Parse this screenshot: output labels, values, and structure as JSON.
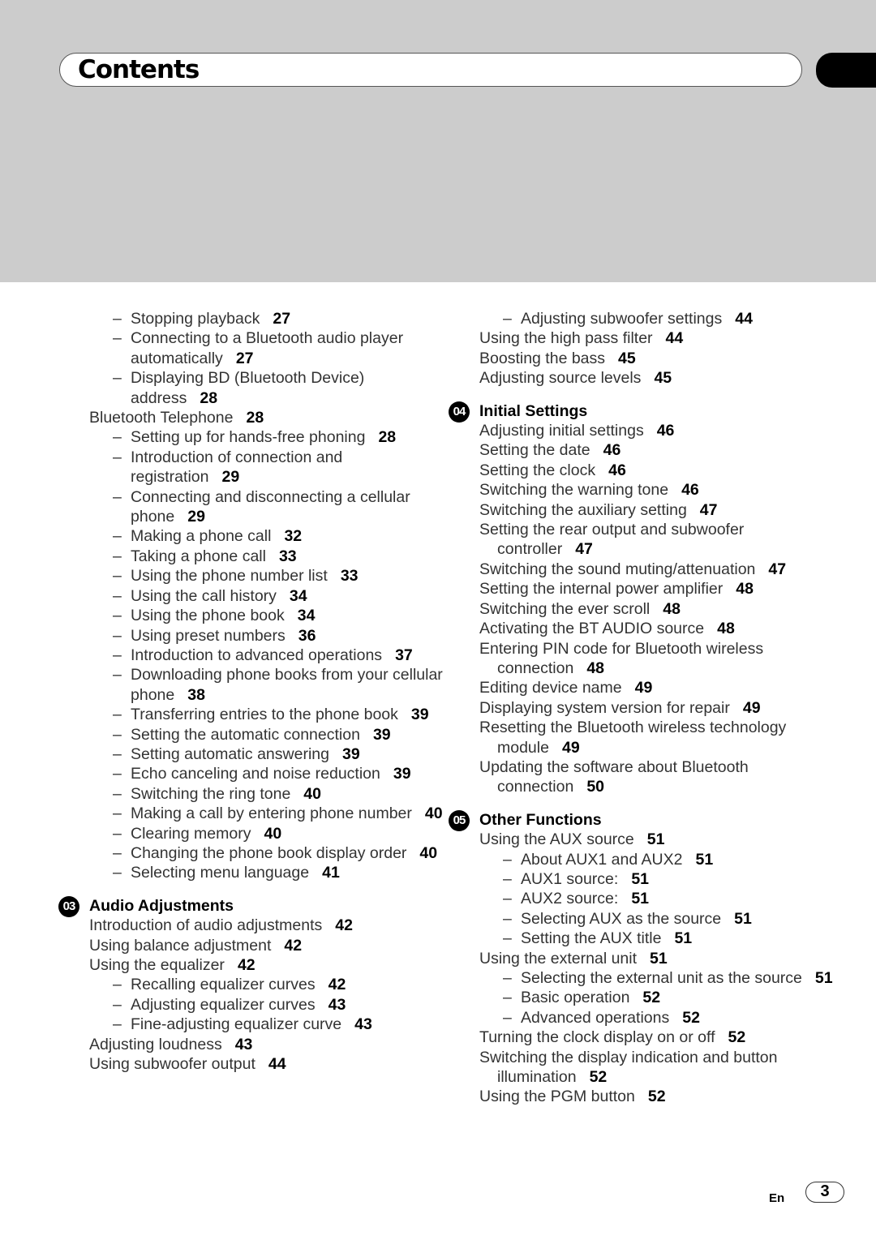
{
  "header": {
    "title": "Contents"
  },
  "left_column": [
    {
      "type": "sub",
      "text": "Stopping playback",
      "page": "27"
    },
    {
      "type": "sub",
      "text": "Connecting to a Bluetooth audio player automatically",
      "page": "27"
    },
    {
      "type": "sub",
      "text": "Displaying BD (Bluetooth Device) address",
      "page": "28"
    },
    {
      "type": "item",
      "text": "Bluetooth Telephone",
      "page": "28"
    },
    {
      "type": "sub",
      "text": "Setting up for hands-free phoning",
      "page": "28"
    },
    {
      "type": "sub",
      "text": "Introduction of connection and registration",
      "page": "29"
    },
    {
      "type": "sub",
      "text": "Connecting and disconnecting a cellular phone",
      "page": "29"
    },
    {
      "type": "sub",
      "text": "Making a phone call",
      "page": "32"
    },
    {
      "type": "sub",
      "text": "Taking a phone call",
      "page": "33"
    },
    {
      "type": "sub",
      "text": "Using the phone number list",
      "page": "33"
    },
    {
      "type": "sub",
      "text": "Using the call history",
      "page": "34"
    },
    {
      "type": "sub",
      "text": "Using the phone book",
      "page": "34"
    },
    {
      "type": "sub",
      "text": "Using preset numbers",
      "page": "36"
    },
    {
      "type": "sub",
      "text": "Introduction to advanced operations",
      "page": "37"
    },
    {
      "type": "sub",
      "text": "Downloading phone books from your cellular phone",
      "page": "38"
    },
    {
      "type": "sub",
      "text": "Transferring entries to the phone book",
      "page": "39"
    },
    {
      "type": "sub",
      "text": "Setting the automatic connection",
      "page": "39"
    },
    {
      "type": "sub",
      "text": "Setting automatic answering",
      "page": "39"
    },
    {
      "type": "sub",
      "text": "Echo canceling and noise reduction",
      "page": "39"
    },
    {
      "type": "sub",
      "text": "Switching the ring tone",
      "page": "40"
    },
    {
      "type": "sub",
      "text": "Making a call by entering phone number",
      "page": "40"
    },
    {
      "type": "sub",
      "text": "Clearing memory",
      "page": "40"
    },
    {
      "type": "sub",
      "text": "Changing the phone book display order",
      "page": "40"
    },
    {
      "type": "sub",
      "text": "Selecting menu language",
      "page": "41"
    },
    {
      "type": "section",
      "number": "03",
      "text": "Audio Adjustments"
    },
    {
      "type": "item",
      "text": "Introduction of audio adjustments",
      "page": "42"
    },
    {
      "type": "item",
      "text": "Using balance adjustment",
      "page": "42"
    },
    {
      "type": "item",
      "text": "Using the equalizer",
      "page": "42"
    },
    {
      "type": "sub",
      "text": "Recalling equalizer curves",
      "page": "42"
    },
    {
      "type": "sub",
      "text": "Adjusting equalizer curves",
      "page": "43"
    },
    {
      "type": "sub",
      "text": "Fine-adjusting equalizer curve",
      "page": "43"
    },
    {
      "type": "item",
      "text": "Adjusting loudness",
      "page": "43"
    },
    {
      "type": "item",
      "text": "Using subwoofer output",
      "page": "44"
    }
  ],
  "right_column": [
    {
      "type": "sub",
      "text": "Adjusting subwoofer settings",
      "page": "44"
    },
    {
      "type": "item",
      "text": "Using the high pass filter",
      "page": "44"
    },
    {
      "type": "item",
      "text": "Boosting the bass",
      "page": "45"
    },
    {
      "type": "item",
      "text": "Adjusting source levels",
      "page": "45"
    },
    {
      "type": "section",
      "number": "04",
      "text": "Initial Settings"
    },
    {
      "type": "item",
      "text": "Adjusting initial settings",
      "page": "46"
    },
    {
      "type": "item",
      "text": "Setting the date",
      "page": "46"
    },
    {
      "type": "item",
      "text": "Setting the clock",
      "page": "46"
    },
    {
      "type": "item",
      "text": "Switching the warning tone",
      "page": "46"
    },
    {
      "type": "item",
      "text": "Switching the auxiliary setting",
      "page": "47"
    },
    {
      "type": "item",
      "text": "Setting the rear output and subwoofer",
      "cont": "controller",
      "page": "47"
    },
    {
      "type": "item",
      "text": "Switching the sound muting/attenuation",
      "page": "47"
    },
    {
      "type": "item",
      "text": "Setting the internal power amplifier",
      "page": "48"
    },
    {
      "type": "item",
      "text": "Switching the ever scroll",
      "page": "48"
    },
    {
      "type": "item",
      "text": "Activating the BT AUDIO source",
      "page": "48"
    },
    {
      "type": "item",
      "text": "Entering PIN code for Bluetooth wireless",
      "cont": "connection",
      "page": "48"
    },
    {
      "type": "item",
      "text": "Editing device name",
      "page": "49"
    },
    {
      "type": "item",
      "text": "Displaying system version for repair",
      "page": "49"
    },
    {
      "type": "item",
      "text": "Resetting the Bluetooth wireless technology",
      "cont": "module",
      "page": "49"
    },
    {
      "type": "item",
      "text": "Updating the software about Bluetooth",
      "cont": "connection",
      "page": "50"
    },
    {
      "type": "section",
      "number": "05",
      "text": "Other Functions"
    },
    {
      "type": "item",
      "text": "Using the AUX source",
      "page": "51"
    },
    {
      "type": "sub",
      "text": "About AUX1 and AUX2",
      "page": "51"
    },
    {
      "type": "sub",
      "text": "AUX1 source:",
      "page": "51"
    },
    {
      "type": "sub",
      "text": "AUX2 source:",
      "page": "51"
    },
    {
      "type": "sub",
      "text": "Selecting AUX as the source",
      "page": "51"
    },
    {
      "type": "sub",
      "text": "Setting the AUX title",
      "page": "51"
    },
    {
      "type": "item",
      "text": "Using the external unit",
      "page": "51"
    },
    {
      "type": "sub",
      "text": "Selecting the external unit as the source",
      "page": "51"
    },
    {
      "type": "sub",
      "text": "Basic operation",
      "page": "52"
    },
    {
      "type": "sub",
      "text": "Advanced operations",
      "page": "52"
    },
    {
      "type": "item",
      "text": "Turning the clock display on or off",
      "page": "52"
    },
    {
      "type": "item",
      "text": "Switching the display indication and button",
      "cont": "illumination",
      "page": "52"
    },
    {
      "type": "item",
      "text": "Using the PGM button",
      "page": "52"
    }
  ],
  "footer": {
    "language": "En",
    "page_number": "3"
  },
  "dash": "–"
}
